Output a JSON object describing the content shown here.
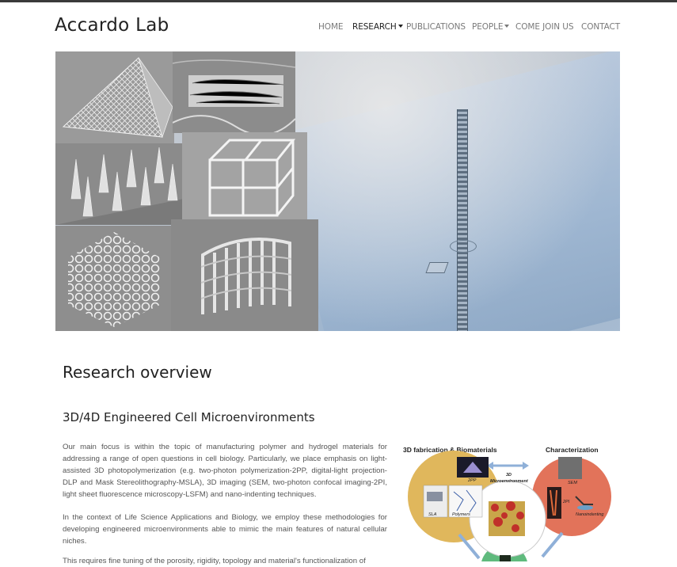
{
  "header": {
    "brand": "Accardo Lab",
    "nav": [
      {
        "label": "HOME",
        "active": false,
        "has_dropdown": false
      },
      {
        "label": "RESEARCH",
        "active": true,
        "has_dropdown": true
      },
      {
        "label": "PUBLICATIONS",
        "active": false,
        "has_dropdown": false
      },
      {
        "label": "PEOPLE",
        "active": false,
        "has_dropdown": true
      },
      {
        "label": "COME JOIN US",
        "active": false,
        "has_dropdown": false
      },
      {
        "label": "CONTACT",
        "active": false,
        "has_dropdown": false
      }
    ]
  },
  "hero": {
    "description": "collage of SEM microstructures over a photo of a 3D printed micro-pillar"
  },
  "content": {
    "page_title": "Research overview",
    "section_title": "3D/4D Engineered Cell Microenvironments",
    "paragraphs": [
      "Our main focus is within the topic of manufacturing polymer and hydrogel materials for addressing a range of open questions in cell biology. Particularly, we place emphasis on light-assisted 3D photopolymerization (e.g. two-photon polymerization-2PP, digital-light projection-DLP and Mask Stereolithography-MSLA), 3D imaging (SEM, two-photon confocal imaging-2PI, light sheet fluorescence microscopy-LSFM) and nano-indenting techniques.",
      "In the context of Life Science Applications and Biology, we employ these methodologies for developing engineered microenvironments able to mimic the main features of natural cellular niches.",
      "This requires fine tuning of the porosity, rigidity, topology and material's functionalization of"
    ]
  },
  "figure": {
    "left_title": "3D fabrication & Biomaterials",
    "right_title": "Characterization",
    "center_label_1": "3D",
    "center_label_2": "Microenvironment",
    "tag_2pp": "2PP",
    "tag_sla": "SLA",
    "tag_polymers": "Polymers",
    "tag_sem": "SEM",
    "tag_2pi": "2PI",
    "tag_nano": "Nanoindenting",
    "colors": {
      "left_circle": "#e0b75c",
      "right_circle": "#e2735a",
      "bottom_circle": "#5fba7d",
      "arrow": "#8fb0d8"
    }
  }
}
